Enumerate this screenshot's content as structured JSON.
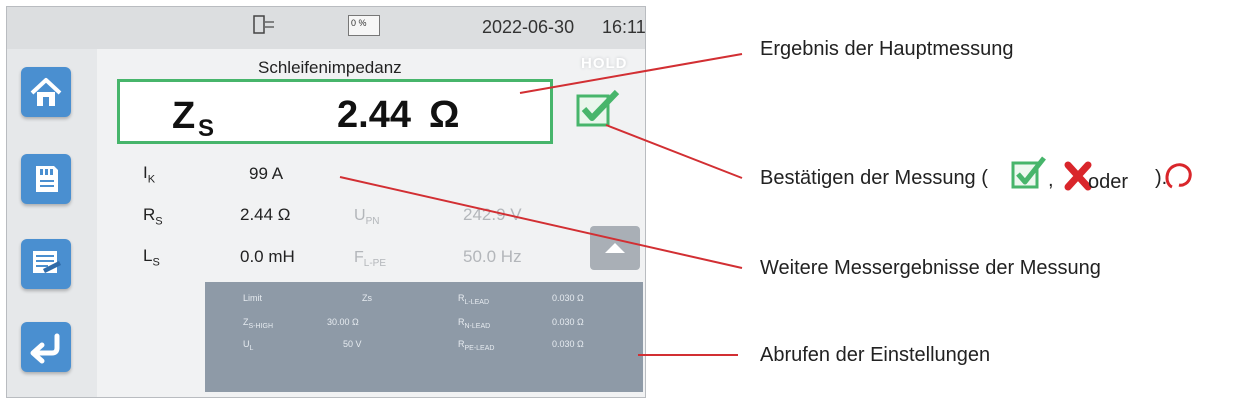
{
  "status_bar": {
    "date": "2022-06-30",
    "time": "16:11",
    "battery_label": "0 %"
  },
  "screen": {
    "title": "Schleifenimpedanz",
    "hold_label": "HOLD",
    "main_result": {
      "symbol": "Z",
      "subscript": "S",
      "value": "2.44",
      "unit": "Ω"
    }
  },
  "secondary": {
    "rows": [
      {
        "symbol": "I",
        "sub": "K",
        "value": "99 A",
        "symbol2": "",
        "sub2": "",
        "value2": ""
      },
      {
        "symbol": "R",
        "sub": "S",
        "value": "2.44 Ω",
        "symbol2": "U",
        "sub2": "PN",
        "value2": "242.9 V"
      },
      {
        "symbol": "L",
        "sub": "S",
        "value": "0.0 mH",
        "symbol2": "F",
        "sub2": "L-PE",
        "value2": "50.0 Hz"
      }
    ]
  },
  "settings": {
    "rows": [
      {
        "c1": "Limit",
        "c1sub": "",
        "c2": "Zs",
        "c3": "R",
        "c3sub": "L-LEAD",
        "c4": "0.030 Ω"
      },
      {
        "c1": "Z",
        "c1sub": "S-HIGH",
        "c2": "30.00 Ω",
        "c3": "R",
        "c3sub": "N-LEAD",
        "c4": "0.030 Ω"
      },
      {
        "c1": "U",
        "c1sub": "L",
        "c2": "50 V",
        "c3": "R",
        "c3sub": "PE-LEAD",
        "c4": "0.030 Ω"
      }
    ]
  },
  "annotations": {
    "main": "Ergebnis der Hauptmessung",
    "confirm_prefix": "Bestätigen der Messung (",
    "confirm_comma": ",",
    "confirm_or": "oder",
    "confirm_suffix": ").",
    "further": "Weitere Messergebnisse der Messung",
    "settings": "Abrufen der Einstellungen"
  },
  "colors": {
    "accent_green": "#47b56b",
    "sidebar_blue": "#4a8fd0",
    "annotation_red": "#d22f33",
    "cross_red": "#d9262b"
  },
  "icons": [
    "home-icon",
    "sd-card-icon",
    "report-icon",
    "back-arrow-icon",
    "check-icon",
    "up-arrow-icon",
    "cross-icon",
    "empty-circle-icon",
    "plug-icon",
    "battery-icon"
  ]
}
